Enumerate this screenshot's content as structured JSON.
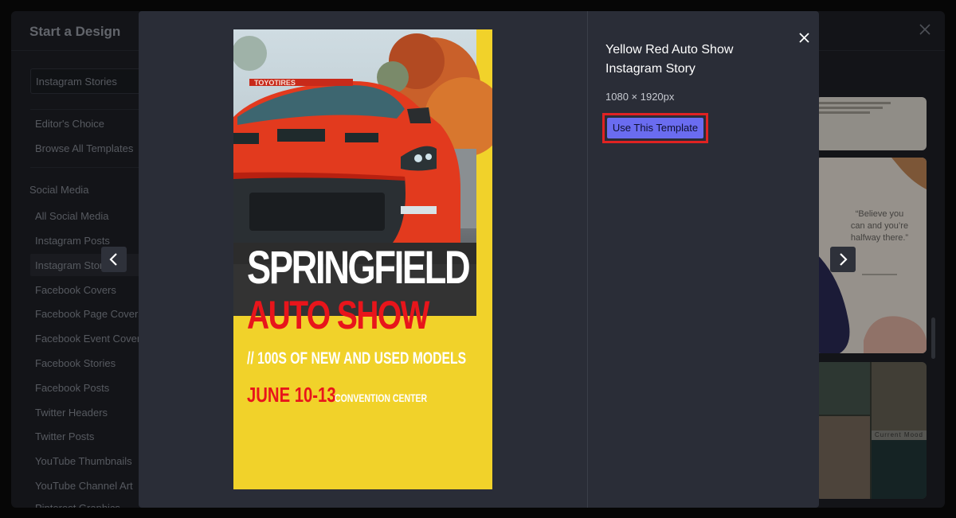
{
  "background_window": {
    "title": "Start a Design",
    "search_value": "Instagram Stories",
    "links": [
      "Editor's Choice",
      "Browse All Templates"
    ],
    "section_heading": "Social Media",
    "categories": [
      "All Social Media",
      "Instagram Posts",
      "Instagram Stories",
      "Facebook Covers",
      "Facebook Page Covers",
      "Facebook Event Covers",
      "Facebook Stories",
      "Facebook Posts",
      "Twitter Headers",
      "Twitter Posts",
      "YouTube Thumbnails",
      "YouTube Channel Art",
      "Pinterest Graphics"
    ],
    "active_category_index": 2,
    "card_quote": "“Believe you can and you’re halfway there.”",
    "card_mood_label": "Current Mood"
  },
  "modal": {
    "template_title": "Yellow Red Auto Show Instagram Story",
    "dimensions": "1080 × 1920px",
    "use_button_label": "Use This Template",
    "preview": {
      "headline": "SPRINGFIELD",
      "subheadline": "AUTO SHOW",
      "tagline": "// 100S OF NEW AND USED MODELS",
      "date": "JUNE 10-13",
      "venue": "CONVENTION CENTER",
      "banner_text": "TOYOTIRES"
    }
  },
  "colors": {
    "accent_button": "#6a6cf0",
    "highlight_outline": "#e02222",
    "poster_yellow": "#f1d22a",
    "poster_red": "#e8151b"
  }
}
